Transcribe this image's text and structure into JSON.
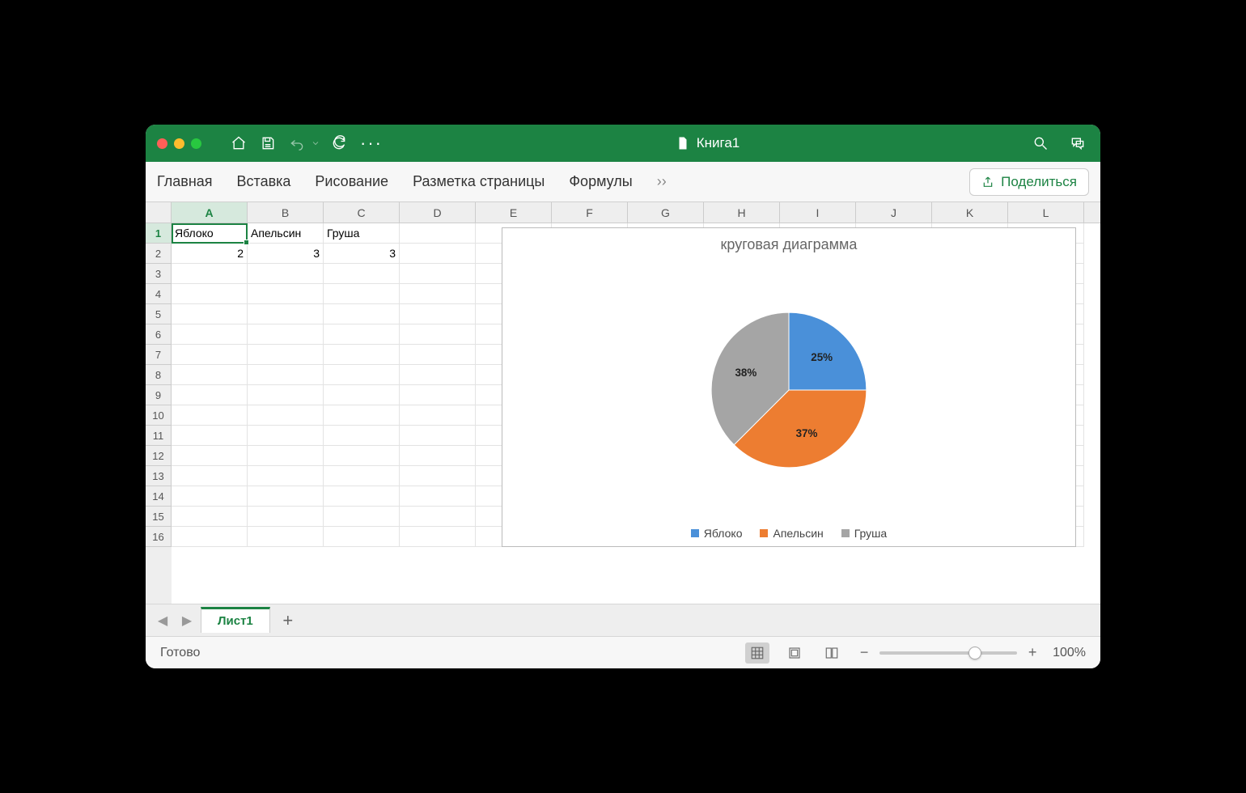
{
  "titlebar": {
    "doc_title": "Книга1"
  },
  "ribbon": {
    "tabs": [
      "Главная",
      "Вставка",
      "Рисование",
      "Разметка страницы",
      "Формулы"
    ],
    "share": "Поделиться"
  },
  "columns": [
    "A",
    "B",
    "C",
    "D",
    "E",
    "F",
    "G",
    "H",
    "I",
    "J",
    "K",
    "L"
  ],
  "rows": 16,
  "selected_cell": {
    "col": 0,
    "row": 0
  },
  "data": {
    "r1": {
      "A": "Яблоко",
      "B": "Апельсин",
      "C": "Груша"
    },
    "r2": {
      "A": "2",
      "B": "3",
      "C": "3"
    }
  },
  "chart_data": {
    "type": "pie",
    "title": "круговая диаграмма",
    "series": [
      {
        "name": "Яблоко",
        "value": 2,
        "pct": "25%",
        "color": "#4a90d9"
      },
      {
        "name": "Апельсин",
        "value": 3,
        "pct": "37%",
        "color": "#ed7d31"
      },
      {
        "name": "Груша",
        "value": 3,
        "pct": "38%",
        "color": "#a5a5a5"
      }
    ]
  },
  "sheettabs": {
    "active": "Лист1"
  },
  "status": {
    "ready": "Готово",
    "zoom": "100%"
  }
}
